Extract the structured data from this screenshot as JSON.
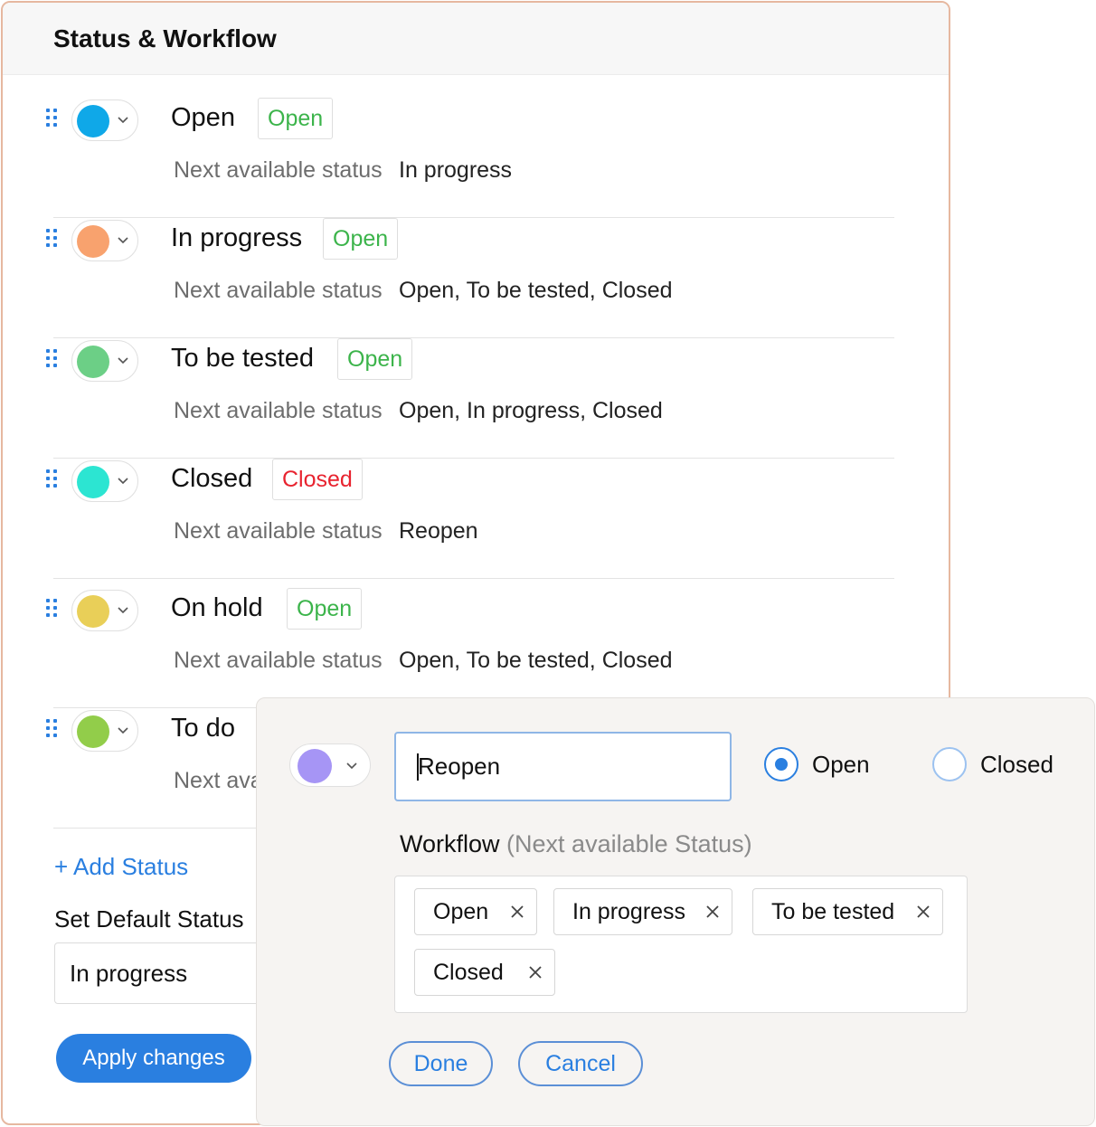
{
  "panel": {
    "title": "Status & Workflow"
  },
  "next_label": "Next available status",
  "statuses": [
    {
      "name": "Open",
      "color": "#0fa8e8",
      "type": "Open",
      "type_color": "#3cb44b",
      "next": "In progress"
    },
    {
      "name": "In progress",
      "color": "#f8a26e",
      "type": "Open",
      "type_color": "#3cb44b",
      "next": "Open, To be tested, Closed"
    },
    {
      "name": "To be tested",
      "color": "#6ccf86",
      "type": "Open",
      "type_color": "#3cb44b",
      "next": "Open, In progress, Closed"
    },
    {
      "name": "Closed",
      "color": "#2ce5d2",
      "type": "Closed",
      "type_color": "#e8232f",
      "next": "Reopen"
    },
    {
      "name": "On hold",
      "color": "#e9cf58",
      "type": "Open",
      "type_color": "#3cb44b",
      "next": "Open, To be tested, Closed"
    },
    {
      "name": "To do",
      "color": "#92cd4a",
      "type": "",
      "type_color": "#3cb44b",
      "next": "Next ava"
    }
  ],
  "add_status": "+ Add Status",
  "default_status": {
    "label": "Set Default Status",
    "value": "In progress"
  },
  "apply_button": "Apply changes",
  "popup": {
    "color": "#a695f5",
    "name_value": "Reopen",
    "radio_open": "Open",
    "radio_closed": "Closed",
    "selected_type": "Open",
    "workflow_label": "Workflow",
    "workflow_sub": "(Next available Status)",
    "tags": [
      "Open",
      "In progress",
      "To be tested",
      "Closed"
    ],
    "done": "Done",
    "cancel": "Cancel"
  },
  "icons": {
    "drag": "drag-handle-icon",
    "chevron": "chevron-down-icon",
    "remove": "close-icon"
  }
}
